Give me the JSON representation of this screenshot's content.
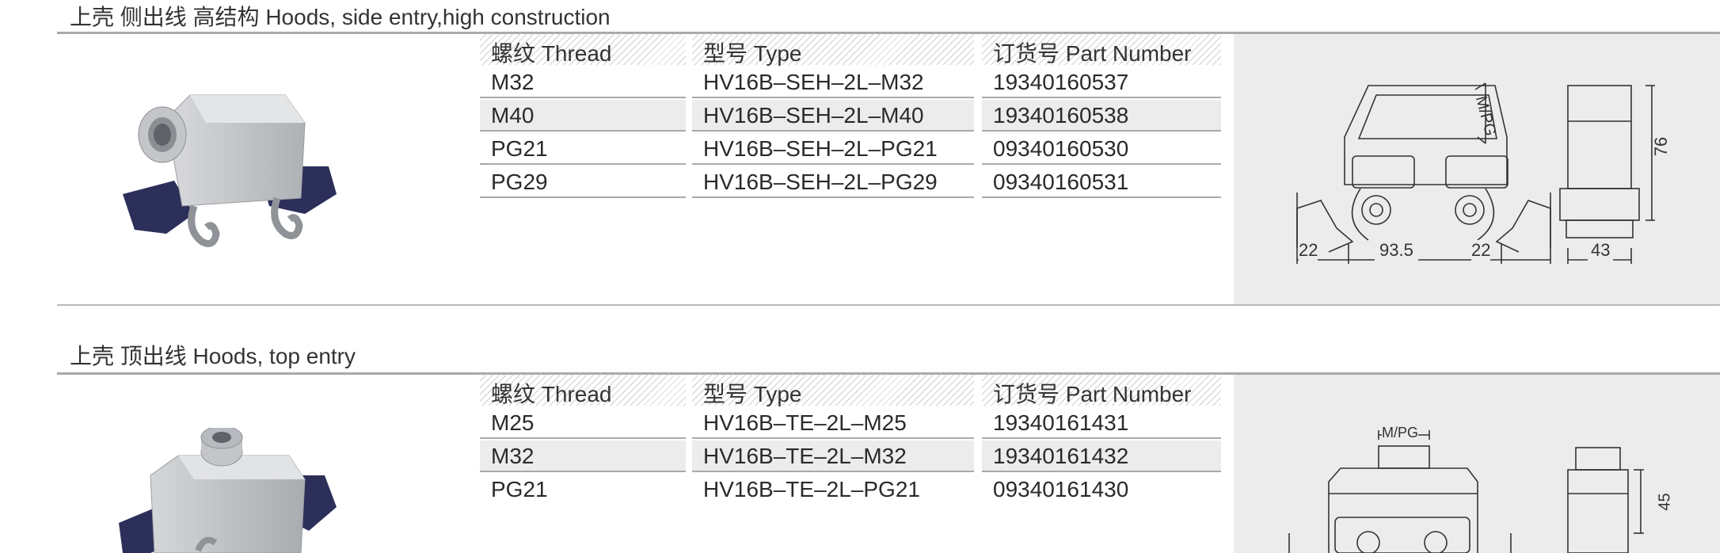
{
  "sections": [
    {
      "title": "上壳 侧出线 高结构  Hoods, side entry,high construction",
      "headers": {
        "thread": "螺纹 Thread",
        "type": "型号 Type",
        "part": "订货号 Part Number"
      },
      "rows": [
        {
          "thread": "M32",
          "type": "HV16B–SEH–2L–M32",
          "part": "19340160537"
        },
        {
          "thread": "M40",
          "type": "HV16B–SEH–2L–M40",
          "part": "19340160538"
        },
        {
          "thread": "PG21",
          "type": "HV16B–SEH–2L–PG21",
          "part": "09340160530"
        },
        {
          "thread": "PG29",
          "type": "HV16B–SEH–2L–PG29",
          "part": "09340160531"
        }
      ],
      "drawing": {
        "mpg": "M/PG",
        "height": "76",
        "left_flange": "22",
        "width": "93.5",
        "right_flange": "22",
        "side_width": "43"
      }
    },
    {
      "title": "上壳 顶出线  Hoods, top entry",
      "headers": {
        "thread": "螺纹 Thread",
        "type": "型号 Type",
        "part": "订货号 Part Number"
      },
      "rows": [
        {
          "thread": "M25",
          "type": "HV16B–TE–2L–M25",
          "part": "19340161431"
        },
        {
          "thread": "M32",
          "type": "HV16B–TE–2L–M32",
          "part": "19340161432"
        },
        {
          "thread": "PG21",
          "type": "HV16B–TE–2L–PG21",
          "part": "09340161430"
        }
      ],
      "drawing": {
        "mpg": "M/PG",
        "height": "45"
      }
    }
  ],
  "colors": {
    "rule": "#a9a9a9",
    "shade": "#ececec",
    "hood": "#c7c9cc",
    "clip": "#2c2f5a"
  }
}
